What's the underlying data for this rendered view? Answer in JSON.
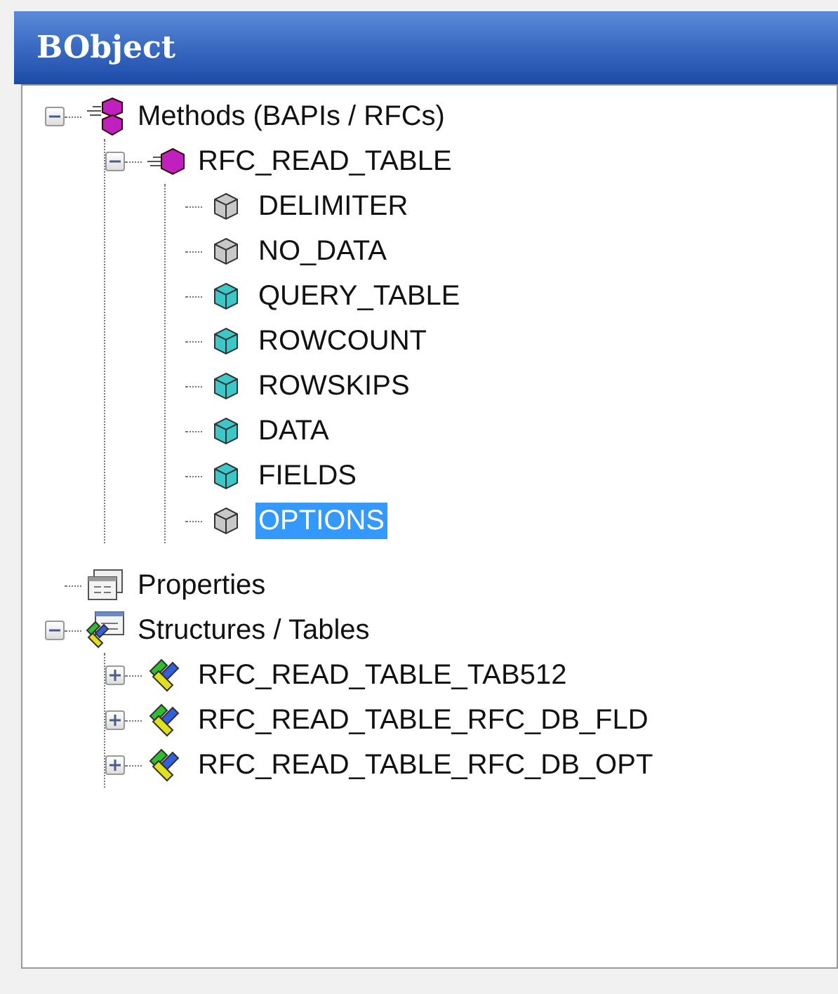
{
  "panel": {
    "title": "BObject"
  },
  "tree": [
    {
      "kind": "methods",
      "label": "Methods (BAPIs / RFCs)",
      "expanded": true,
      "selected": false,
      "children": [
        {
          "kind": "method",
          "label": "RFC_READ_TABLE",
          "expanded": true,
          "selected": false,
          "children": [
            {
              "kind": "param",
              "label": "DELIMITER",
              "color": "#c8c8c8",
              "selected": false
            },
            {
              "kind": "param",
              "label": "NO_DATA",
              "color": "#c8c8c8",
              "selected": false
            },
            {
              "kind": "param",
              "label": "QUERY_TABLE",
              "color": "#3cc8c8",
              "selected": false
            },
            {
              "kind": "param",
              "label": "ROWCOUNT",
              "color": "#3cc8c8",
              "selected": false
            },
            {
              "kind": "param",
              "label": "ROWSKIPS",
              "color": "#3cc8c8",
              "selected": false
            },
            {
              "kind": "param",
              "label": "DATA",
              "color": "#3cc8c8",
              "selected": false
            },
            {
              "kind": "param",
              "label": "FIELDS",
              "color": "#3cc8c8",
              "selected": false
            },
            {
              "kind": "param",
              "label": "OPTIONS",
              "color": "#c8c8c8",
              "selected": true
            }
          ]
        }
      ]
    },
    {
      "kind": "properties",
      "label": "Properties",
      "selected": false
    },
    {
      "kind": "structures",
      "label": "Structures / Tables",
      "expanded": true,
      "selected": false,
      "children": [
        {
          "kind": "structure",
          "label": "RFC_READ_TABLE_TAB512",
          "expanded": false,
          "selected": false
        },
        {
          "kind": "structure",
          "label": "RFC_READ_TABLE_RFC_DB_FLD",
          "expanded": false,
          "selected": false
        },
        {
          "kind": "structure",
          "label": "RFC_READ_TABLE_RFC_DB_OPT",
          "expanded": false,
          "selected": false
        }
      ]
    }
  ]
}
